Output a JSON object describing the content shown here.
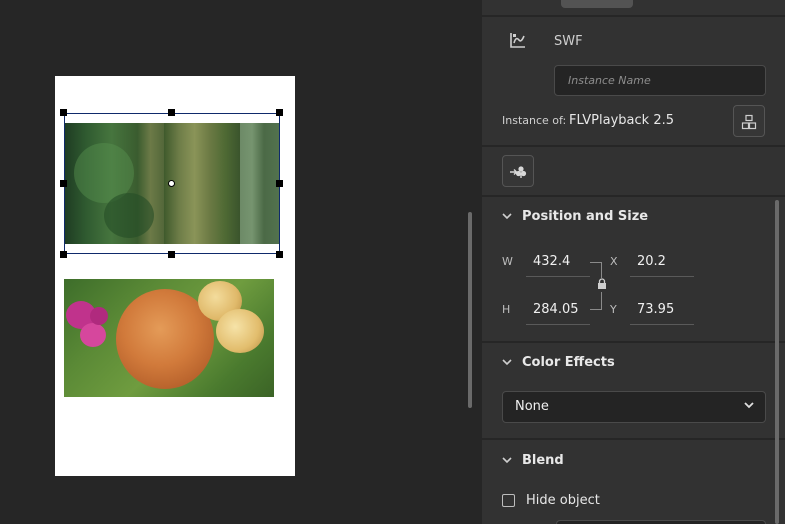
{
  "stage": {
    "images": [
      {
        "name": "forest-image"
      },
      {
        "name": "food-image"
      }
    ]
  },
  "panel": {
    "swf_icon": "swf-symbol-icon",
    "type_label": "SWF",
    "instance_name_placeholder": "Instance Name",
    "instance_of_label": "Instance of:",
    "instance_of_value": "FLVPlayback 2.5",
    "swap_icon": "swap-symbol-icon",
    "action_icon": "add-action-icon",
    "position_size": {
      "title": "Position and Size",
      "w_label": "W",
      "w_value": "432.4",
      "h_label": "H",
      "h_value": "284.05",
      "x_label": "X",
      "x_value": "20.2",
      "y_label": "Y",
      "y_value": "73.95"
    },
    "color_effects": {
      "title": "Color Effects",
      "selected": "None"
    },
    "blend": {
      "title": "Blend",
      "hide_object_label": "Hide object"
    }
  }
}
